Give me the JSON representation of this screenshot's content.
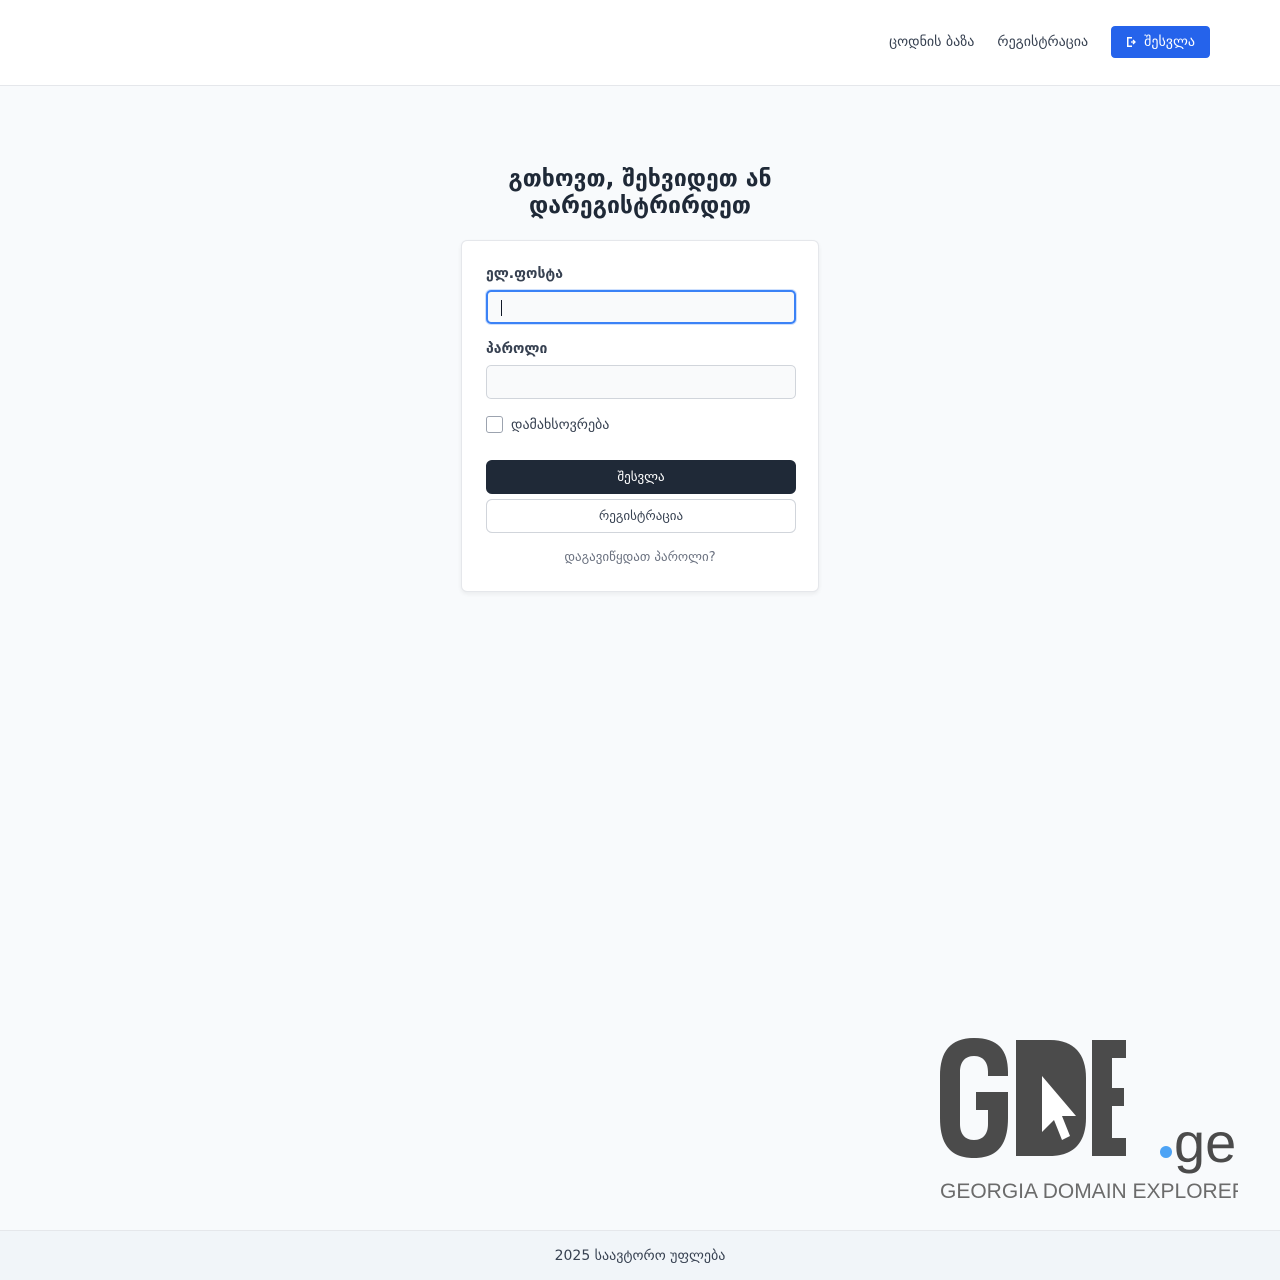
{
  "header": {
    "nav": {
      "knowledge_base": "ცოდნის ბაზა",
      "register": "რეგისტრაცია",
      "login_button": "შესვლა",
      "login_icon": "sign-in-icon"
    }
  },
  "main": {
    "title_line1": "გთხოვთ, შეხვიდეთ ან",
    "title_line2": "დარეგისტრირდეთ",
    "form": {
      "email_label": "ელ.ფოსტა",
      "email_value": "",
      "password_label": "პაროლი",
      "password_value": "",
      "remember_label": "დამახსოვრება",
      "remember_checked": false,
      "login_button": "შესვლა",
      "register_button": "რეგისტრაცია",
      "forgot_link": "დაგავიწყდათ პაროლი?"
    }
  },
  "logo": {
    "main_text": "GDE",
    "suffix": ".ge",
    "tagline": "GEORGIA DOMAIN EXPLORER",
    "colors": {
      "text": "#4b4b4b",
      "dot": "#4da3f5",
      "tagline": "#6b6b6b"
    }
  },
  "footer": {
    "text": "2025 საავტორო უფლება"
  },
  "colors": {
    "accent": "#2563eb",
    "primary_button": "#1f2937",
    "focus_ring": "#3b82f6"
  }
}
